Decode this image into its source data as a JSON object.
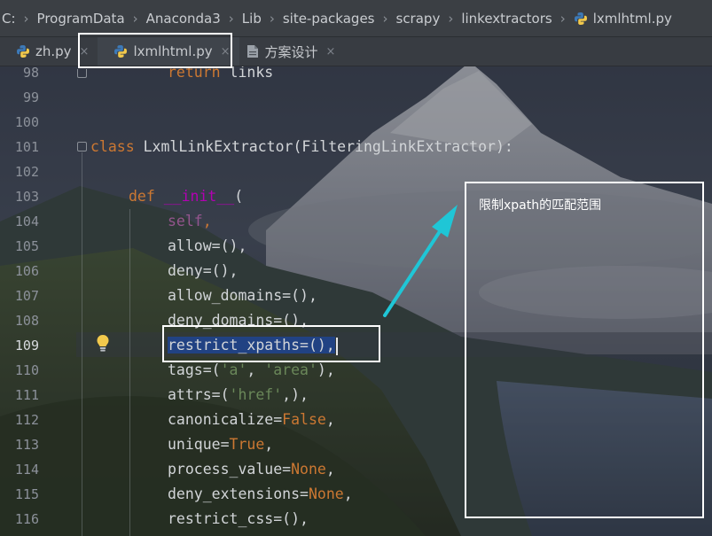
{
  "breadcrumb": {
    "items": [
      "C:",
      "ProgramData",
      "Anaconda3",
      "Lib",
      "site-packages",
      "scrapy",
      "linkextractors",
      "lxmlhtml.py"
    ],
    "separator": "›"
  },
  "tabs": [
    {
      "label": "zh.py",
      "close": "×"
    },
    {
      "label": "lxmlhtml.py",
      "close": "×"
    },
    {
      "label": "方案设计",
      "close": "×"
    }
  ],
  "line_numbers": [
    "98",
    "99",
    "100",
    "101",
    "102",
    "103",
    "104",
    "105",
    "106",
    "107",
    "108",
    "109",
    "110",
    "111",
    "112",
    "113",
    "114",
    "115",
    "116"
  ],
  "code": {
    "l98": {
      "kw": "return",
      "rest": " links"
    },
    "l101": {
      "kw": "class",
      "rest": " LxmlLinkExtractor(FilteringLinkExtractor):"
    },
    "l103": {
      "kw": "def",
      "name": "__init__",
      "rest": "("
    },
    "l104": {
      "self": "self",
      "rest": ","
    },
    "l105": "allow=(),",
    "l106": "deny=(),",
    "l107": "allow_domains=(),",
    "l108": "deny_domains=(),",
    "l109": {
      "selected": "restrict_xpaths=(),"
    },
    "l110": {
      "a": "tags=(",
      "s1": "'a'",
      "b": ", ",
      "s2": "'area'",
      "c": "),"
    },
    "l111": {
      "a": "attrs=(",
      "s1": "'href'",
      "c": ",),"
    },
    "l112": {
      "a": "canonicalize=",
      "v": "False",
      "c": ","
    },
    "l113": {
      "a": "unique=",
      "v": "True",
      "c": ","
    },
    "l114": {
      "a": "process_value=",
      "v": "None",
      "c": ","
    },
    "l115": {
      "a": "deny_extensions=",
      "v": "None",
      "c": ","
    },
    "l116": "restrict_css=(),"
  },
  "annotation": {
    "note": "限制xpath的匹配范围"
  },
  "colors": {
    "keyword": "#cc7832",
    "magic": "#b200b2",
    "self": "#94558d",
    "string": "#6a8759",
    "selection": "#214283",
    "arrow": "#1fc6d6"
  },
  "icons": [
    "python-file-icon",
    "document-icon",
    "lightbulb-icon"
  ]
}
